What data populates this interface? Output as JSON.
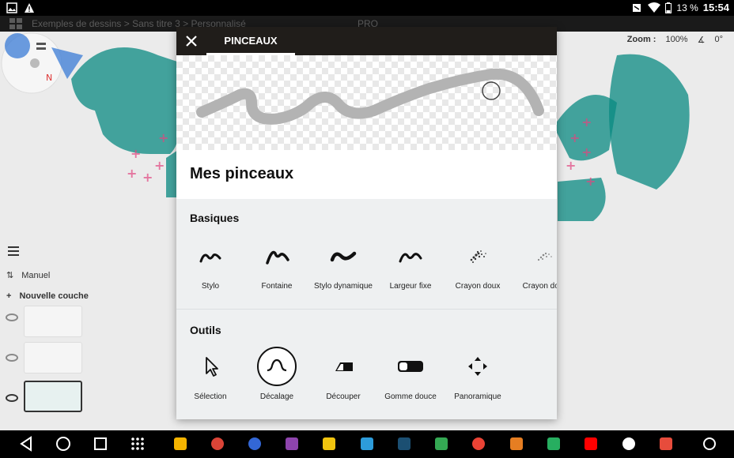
{
  "status_bar": {
    "battery": "13 %",
    "time": "15:54"
  },
  "app_bar": {
    "breadcrumb": "Exemples de dessins  >  Sans titre 3  >  Personnalisé",
    "edition": "PRO"
  },
  "canvas": {
    "zoom_label": "Zoom :",
    "zoom_value": "100%",
    "rotation_value": "0°"
  },
  "layers": {
    "mode_label": "Manuel",
    "new_layer_label": "Nouvelle couche"
  },
  "dialog": {
    "tab_label": "PINCEAUX",
    "section_title": "Mes pinceaux",
    "basic_title": "Basiques",
    "basic_brushes": [
      {
        "label": "Stylo",
        "icon": "stylo-stroke-icon"
      },
      {
        "label": "Fontaine",
        "icon": "fountain-stroke-icon"
      },
      {
        "label": "Stylo dynamique",
        "icon": "dynamic-pen-stroke-icon"
      },
      {
        "label": "Largeur fixe",
        "icon": "fixed-width-stroke-icon"
      },
      {
        "label": "Crayon doux",
        "icon": "soft-pencil-icon"
      },
      {
        "label": "Crayon doux",
        "icon": "soft-pencil-icon"
      }
    ],
    "tools_title": "Outils",
    "tools": [
      {
        "label": "Sélection",
        "icon": "cursor-arrow-icon"
      },
      {
        "label": "Décalage",
        "icon": "offset-wave-icon"
      },
      {
        "label": "Découper",
        "icon": "cut-eraser-icon"
      },
      {
        "label": "Gomme douce",
        "icon": "soft-eraser-icon"
      },
      {
        "label": "Panoramique",
        "icon": "pan-arrows-icon"
      }
    ]
  },
  "colors": {
    "teal": "#0a8a82",
    "pink": "#e2457f",
    "blue": "#3a7bd5",
    "header": "#201d1a"
  }
}
